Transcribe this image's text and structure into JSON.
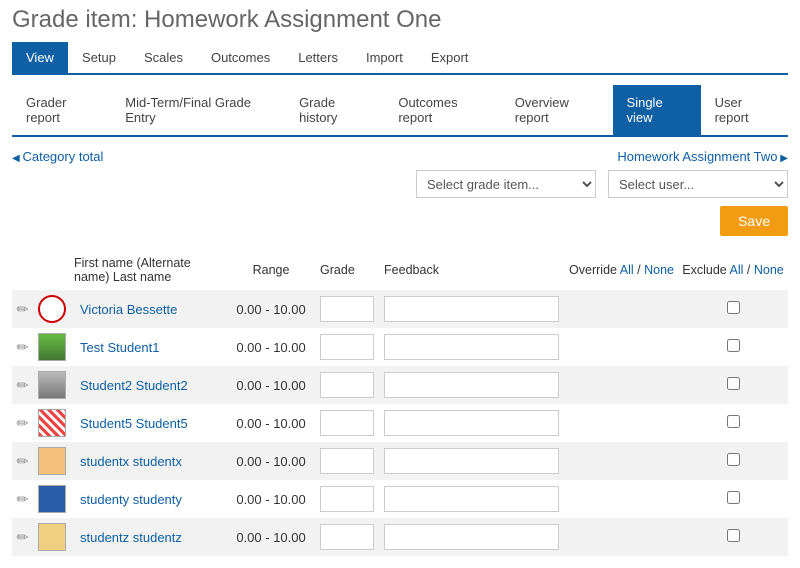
{
  "page_title": "Grade item: Homework Assignment One",
  "primary_tabs": [
    "View",
    "Setup",
    "Scales",
    "Outcomes",
    "Letters",
    "Import",
    "Export"
  ],
  "primary_active": 0,
  "secondary_tabs": [
    "Grader report",
    "Mid-Term/Final Grade Entry",
    "Grade history",
    "Outcomes report",
    "Overview report",
    "Single view",
    "User report"
  ],
  "secondary_active": 5,
  "nav_prev": "Category total",
  "nav_next": "Homework Assignment Two",
  "select_grade_item_placeholder": "Select grade item...",
  "select_user_placeholder": "Select user...",
  "save_label": "Save",
  "columns": {
    "name": "First name (Alternate name) Last name",
    "range": "Range",
    "grade": "Grade",
    "feedback": "Feedback",
    "override": "Override",
    "exclude": "Exclude"
  },
  "allnone": {
    "all": "All",
    "none": "None",
    "sep": " / "
  },
  "rows": [
    {
      "name": "Victoria Bessette",
      "range": "0.00 - 10.00",
      "grade": "",
      "feedback": "",
      "exclude": false
    },
    {
      "name": "Test Student1",
      "range": "0.00 - 10.00",
      "grade": "",
      "feedback": "",
      "exclude": false
    },
    {
      "name": "Student2 Student2",
      "range": "0.00 - 10.00",
      "grade": "",
      "feedback": "",
      "exclude": false
    },
    {
      "name": "Student5 Student5",
      "range": "0.00 - 10.00",
      "grade": "",
      "feedback": "",
      "exclude": false
    },
    {
      "name": "studentx studentx",
      "range": "0.00 - 10.00",
      "grade": "",
      "feedback": "",
      "exclude": false
    },
    {
      "name": "studenty studenty",
      "range": "0.00 - 10.00",
      "grade": "",
      "feedback": "",
      "exclude": false
    },
    {
      "name": "studentz studentz",
      "range": "0.00 - 10.00",
      "grade": "",
      "feedback": "",
      "exclude": false
    }
  ]
}
